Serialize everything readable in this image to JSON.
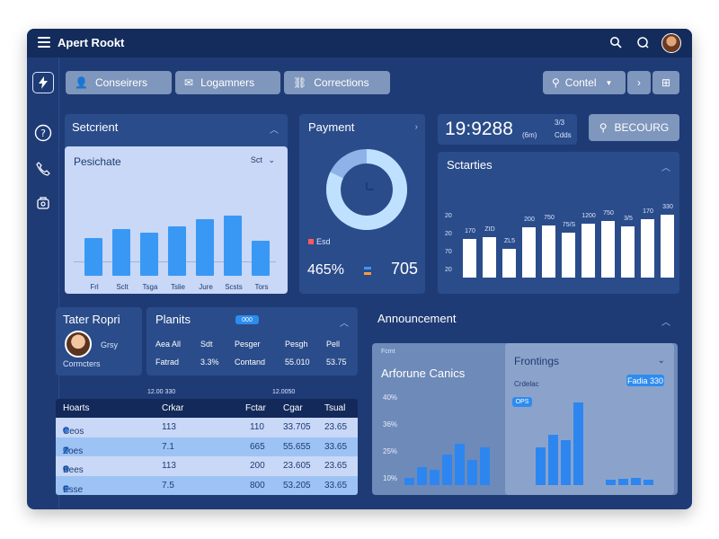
{
  "app": {
    "title": "Apert Rookt"
  },
  "toolbar": {
    "chips": [
      {
        "label": "Conseirers",
        "icon": "user-icon"
      },
      {
        "label": "Logamners",
        "icon": "mail-icon"
      },
      {
        "label": "Corrections",
        "icon": "link-icon"
      }
    ],
    "control_label": "Contel"
  },
  "sidebar": {
    "icons": [
      "lightning-icon",
      "help-icon",
      "phone-icon",
      "badge-icon"
    ]
  },
  "selection_panel": {
    "title": "Setcrient",
    "card_title": "Pesichate",
    "card_select": "Sct",
    "categories": [
      "Frl",
      "Sclt",
      "Tsga",
      "Tslie",
      "Jure",
      "Scsts",
      "Tors"
    ],
    "values": [
      50,
      62,
      57,
      65,
      75,
      80,
      46
    ]
  },
  "payment_panel": {
    "title": "Payment",
    "legend_label": "Esd",
    "percent": "465%",
    "value": "705",
    "fill_fraction": 0.82
  },
  "kpi": {
    "value": "19:9288",
    "sub1": "(6m)",
    "sub2": "3/3",
    "sub3": "Cdds"
  },
  "location_button": {
    "label": "BECOURG"
  },
  "stats_panel": {
    "title": "Sctarties",
    "ytick": [
      "20",
      "20",
      "70",
      "20"
    ],
    "values": [
      48,
      50,
      36,
      62,
      64,
      55,
      67,
      70,
      63,
      72,
      78
    ],
    "labels": [
      "170",
      "ZID",
      "ZL5",
      "200",
      "750",
      "75/S",
      "1200",
      "750",
      "3/5",
      "170",
      "330"
    ]
  },
  "teller": {
    "title": "Tater Ropri",
    "role": "Grsy",
    "company": "Cormcters"
  },
  "plans": {
    "title": "Planits",
    "badge": "000",
    "row1": [
      "Aea All",
      "Sdt",
      "Pesger",
      "Pesgh",
      "Pell"
    ],
    "row2": [
      "Fatrad",
      "3.3%",
      "Contand",
      "55.010",
      "53.75"
    ]
  },
  "table": {
    "caption_left": "12.00 330",
    "caption_right": "12.0050",
    "headers": [
      "Hoarts",
      "Crkar",
      "Fctar",
      "Cgar",
      "Tsual"
    ],
    "rows": [
      [
        "Ceos",
        "113",
        "110",
        "33.705",
        "23.65"
      ],
      [
        "Zoes",
        "7.1",
        "665",
        "55.655",
        "33.65"
      ],
      [
        "Bees",
        "113",
        "200",
        "23.605",
        "23.65"
      ],
      [
        "Esse",
        "7.5",
        "800",
        "53.205",
        "33.65"
      ]
    ]
  },
  "announcement": {
    "title": "Announcement",
    "card_title": "Arforune Canics",
    "card_tag": "Fcmt",
    "yticks": [
      "40%",
      "36%",
      "25%",
      "10%"
    ],
    "values": [
      8,
      20,
      17,
      34,
      46,
      28,
      42
    ],
    "frontings": {
      "title": "Frontings",
      "subtitle": "Crdelac",
      "pill": "OPS",
      "button": "Fadia 330",
      "values": [
        42,
        56,
        50,
        92,
        6,
        7,
        8,
        6
      ]
    }
  }
}
